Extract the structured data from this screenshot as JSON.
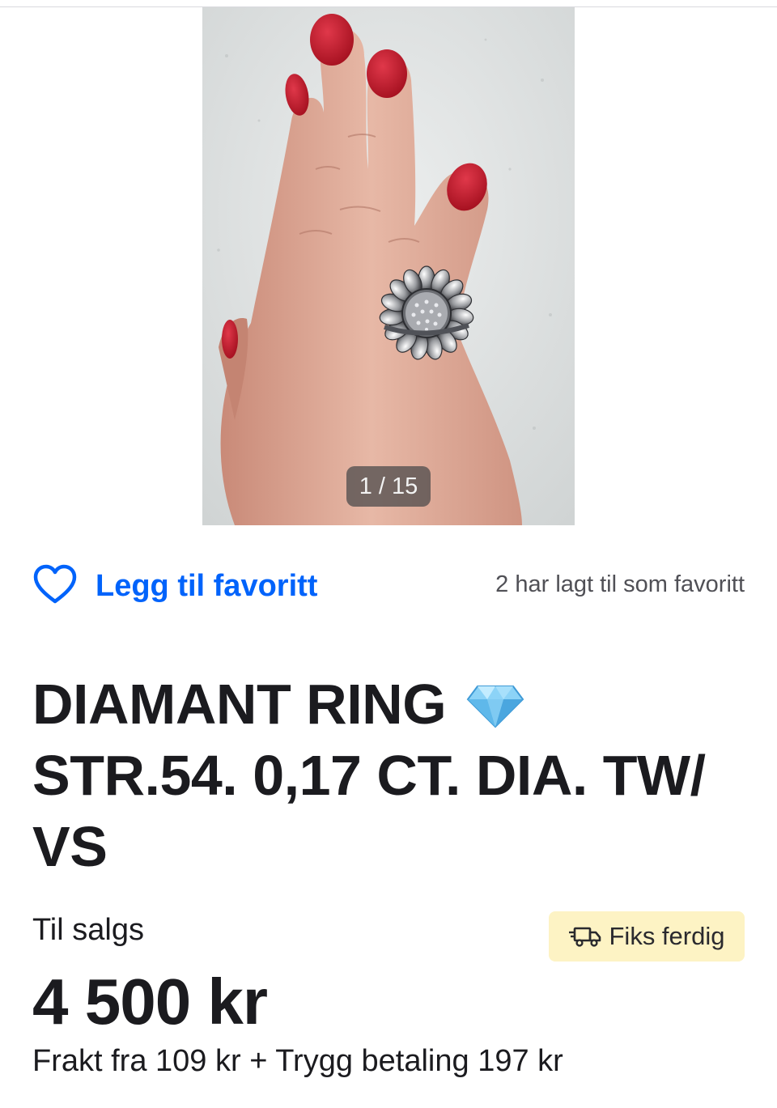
{
  "gallery": {
    "counter": "1 / 15",
    "image_alt": "Sunflower diamond ring on hand with red glitter nails"
  },
  "favorite": {
    "button_label": "Legg til favoritt",
    "count_text": "2 har lagt til som favoritt",
    "accent_color": "#0063fb"
  },
  "listing": {
    "title": "DIAMANT RING",
    "title_rest": "STR.54. 0,17 CT. DIA. TW/ VS",
    "title_icon": "gem-icon",
    "status": "Til salgs",
    "badge": {
      "icon": "truck-icon",
      "label": "Fiks ferdig",
      "bg_color": "#fdf3c4"
    },
    "price": "4 500 kr",
    "shipping": "Frakt fra 109 kr + Trygg betaling 197 kr"
  }
}
